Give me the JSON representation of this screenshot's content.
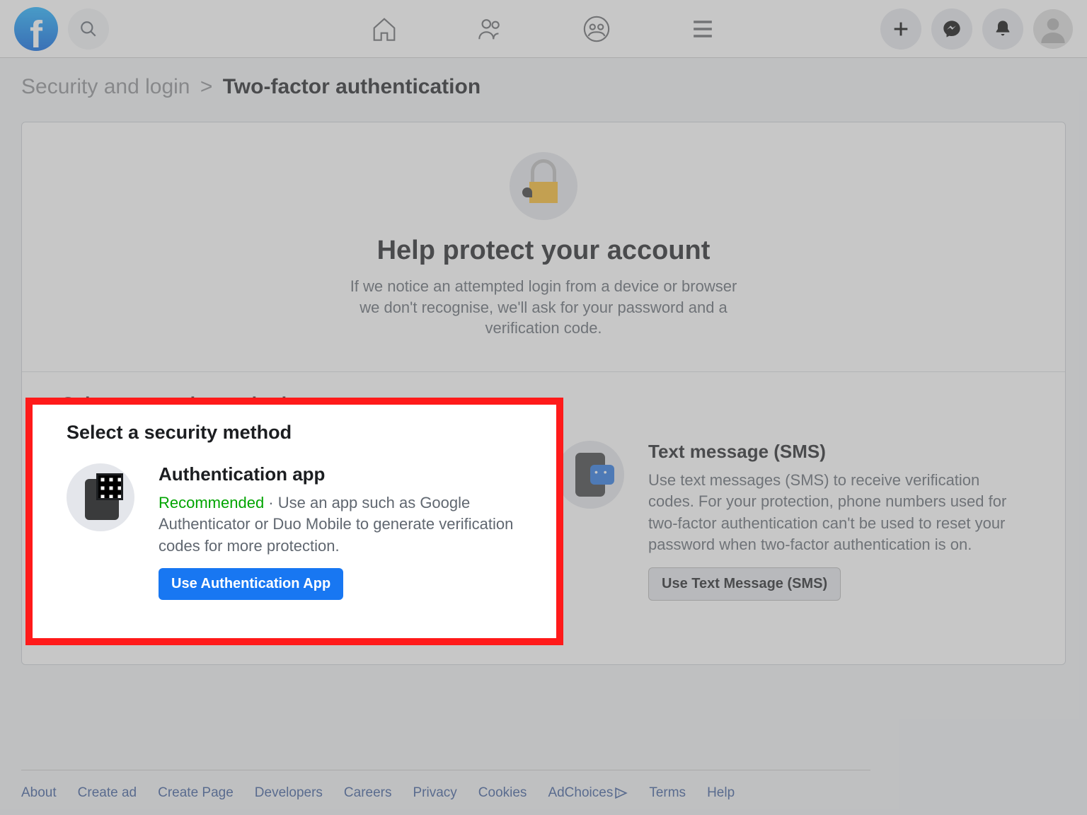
{
  "breadcrumb": {
    "parent": "Security and login",
    "current": "Two-factor authentication"
  },
  "hero": {
    "title": "Help protect your account",
    "desc": "If we notice an attempted login from a device or browser we don't recognise, we'll ask for your password and a verification code."
  },
  "section_title": "Select a security method",
  "methods": {
    "app": {
      "title": "Authentication app",
      "recommended": "Recommended",
      "sep": " · ",
      "desc": "Use an app such as Google Authenticator or Duo Mobile to generate verification codes for more protection.",
      "button": "Use Authentication App"
    },
    "sms": {
      "title": "Text message (SMS)",
      "desc": "Use text messages (SMS) to receive verification codes. For your protection, phone numbers used for two-factor authentication can't be used to reset your password when two-factor authentication is on.",
      "button": "Use Text Message (SMS)"
    }
  },
  "footer": [
    "About",
    "Create ad",
    "Create Page",
    "Developers",
    "Careers",
    "Privacy",
    "Cookies",
    "AdChoices",
    "Terms",
    "Help"
  ],
  "colors": {
    "brand": "#1877f2",
    "highlight": "#ff1a1a",
    "recommended": "#00a400"
  }
}
